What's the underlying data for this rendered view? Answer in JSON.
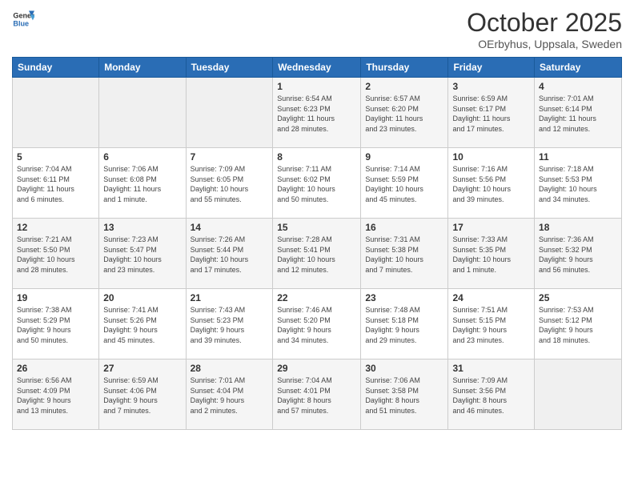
{
  "header": {
    "logo_line1": "General",
    "logo_line2": "Blue",
    "month": "October 2025",
    "location": "OErbyhus, Uppsala, Sweden"
  },
  "weekdays": [
    "Sunday",
    "Monday",
    "Tuesday",
    "Wednesday",
    "Thursday",
    "Friday",
    "Saturday"
  ],
  "weeks": [
    [
      {
        "day": "",
        "info": ""
      },
      {
        "day": "",
        "info": ""
      },
      {
        "day": "",
        "info": ""
      },
      {
        "day": "1",
        "info": "Sunrise: 6:54 AM\nSunset: 6:23 PM\nDaylight: 11 hours\nand 28 minutes."
      },
      {
        "day": "2",
        "info": "Sunrise: 6:57 AM\nSunset: 6:20 PM\nDaylight: 11 hours\nand 23 minutes."
      },
      {
        "day": "3",
        "info": "Sunrise: 6:59 AM\nSunset: 6:17 PM\nDaylight: 11 hours\nand 17 minutes."
      },
      {
        "day": "4",
        "info": "Sunrise: 7:01 AM\nSunset: 6:14 PM\nDaylight: 11 hours\nand 12 minutes."
      }
    ],
    [
      {
        "day": "5",
        "info": "Sunrise: 7:04 AM\nSunset: 6:11 PM\nDaylight: 11 hours\nand 6 minutes."
      },
      {
        "day": "6",
        "info": "Sunrise: 7:06 AM\nSunset: 6:08 PM\nDaylight: 11 hours\nand 1 minute."
      },
      {
        "day": "7",
        "info": "Sunrise: 7:09 AM\nSunset: 6:05 PM\nDaylight: 10 hours\nand 55 minutes."
      },
      {
        "day": "8",
        "info": "Sunrise: 7:11 AM\nSunset: 6:02 PM\nDaylight: 10 hours\nand 50 minutes."
      },
      {
        "day": "9",
        "info": "Sunrise: 7:14 AM\nSunset: 5:59 PM\nDaylight: 10 hours\nand 45 minutes."
      },
      {
        "day": "10",
        "info": "Sunrise: 7:16 AM\nSunset: 5:56 PM\nDaylight: 10 hours\nand 39 minutes."
      },
      {
        "day": "11",
        "info": "Sunrise: 7:18 AM\nSunset: 5:53 PM\nDaylight: 10 hours\nand 34 minutes."
      }
    ],
    [
      {
        "day": "12",
        "info": "Sunrise: 7:21 AM\nSunset: 5:50 PM\nDaylight: 10 hours\nand 28 minutes."
      },
      {
        "day": "13",
        "info": "Sunrise: 7:23 AM\nSunset: 5:47 PM\nDaylight: 10 hours\nand 23 minutes."
      },
      {
        "day": "14",
        "info": "Sunrise: 7:26 AM\nSunset: 5:44 PM\nDaylight: 10 hours\nand 17 minutes."
      },
      {
        "day": "15",
        "info": "Sunrise: 7:28 AM\nSunset: 5:41 PM\nDaylight: 10 hours\nand 12 minutes."
      },
      {
        "day": "16",
        "info": "Sunrise: 7:31 AM\nSunset: 5:38 PM\nDaylight: 10 hours\nand 7 minutes."
      },
      {
        "day": "17",
        "info": "Sunrise: 7:33 AM\nSunset: 5:35 PM\nDaylight: 10 hours\nand 1 minute."
      },
      {
        "day": "18",
        "info": "Sunrise: 7:36 AM\nSunset: 5:32 PM\nDaylight: 9 hours\nand 56 minutes."
      }
    ],
    [
      {
        "day": "19",
        "info": "Sunrise: 7:38 AM\nSunset: 5:29 PM\nDaylight: 9 hours\nand 50 minutes."
      },
      {
        "day": "20",
        "info": "Sunrise: 7:41 AM\nSunset: 5:26 PM\nDaylight: 9 hours\nand 45 minutes."
      },
      {
        "day": "21",
        "info": "Sunrise: 7:43 AM\nSunset: 5:23 PM\nDaylight: 9 hours\nand 39 minutes."
      },
      {
        "day": "22",
        "info": "Sunrise: 7:46 AM\nSunset: 5:20 PM\nDaylight: 9 hours\nand 34 minutes."
      },
      {
        "day": "23",
        "info": "Sunrise: 7:48 AM\nSunset: 5:18 PM\nDaylight: 9 hours\nand 29 minutes."
      },
      {
        "day": "24",
        "info": "Sunrise: 7:51 AM\nSunset: 5:15 PM\nDaylight: 9 hours\nand 23 minutes."
      },
      {
        "day": "25",
        "info": "Sunrise: 7:53 AM\nSunset: 5:12 PM\nDaylight: 9 hours\nand 18 minutes."
      }
    ],
    [
      {
        "day": "26",
        "info": "Sunrise: 6:56 AM\nSunset: 4:09 PM\nDaylight: 9 hours\nand 13 minutes."
      },
      {
        "day": "27",
        "info": "Sunrise: 6:59 AM\nSunset: 4:06 PM\nDaylight: 9 hours\nand 7 minutes."
      },
      {
        "day": "28",
        "info": "Sunrise: 7:01 AM\nSunset: 4:04 PM\nDaylight: 9 hours\nand 2 minutes."
      },
      {
        "day": "29",
        "info": "Sunrise: 7:04 AM\nSunset: 4:01 PM\nDaylight: 8 hours\nand 57 minutes."
      },
      {
        "day": "30",
        "info": "Sunrise: 7:06 AM\nSunset: 3:58 PM\nDaylight: 8 hours\nand 51 minutes."
      },
      {
        "day": "31",
        "info": "Sunrise: 7:09 AM\nSunset: 3:56 PM\nDaylight: 8 hours\nand 46 minutes."
      },
      {
        "day": "",
        "info": ""
      }
    ]
  ]
}
